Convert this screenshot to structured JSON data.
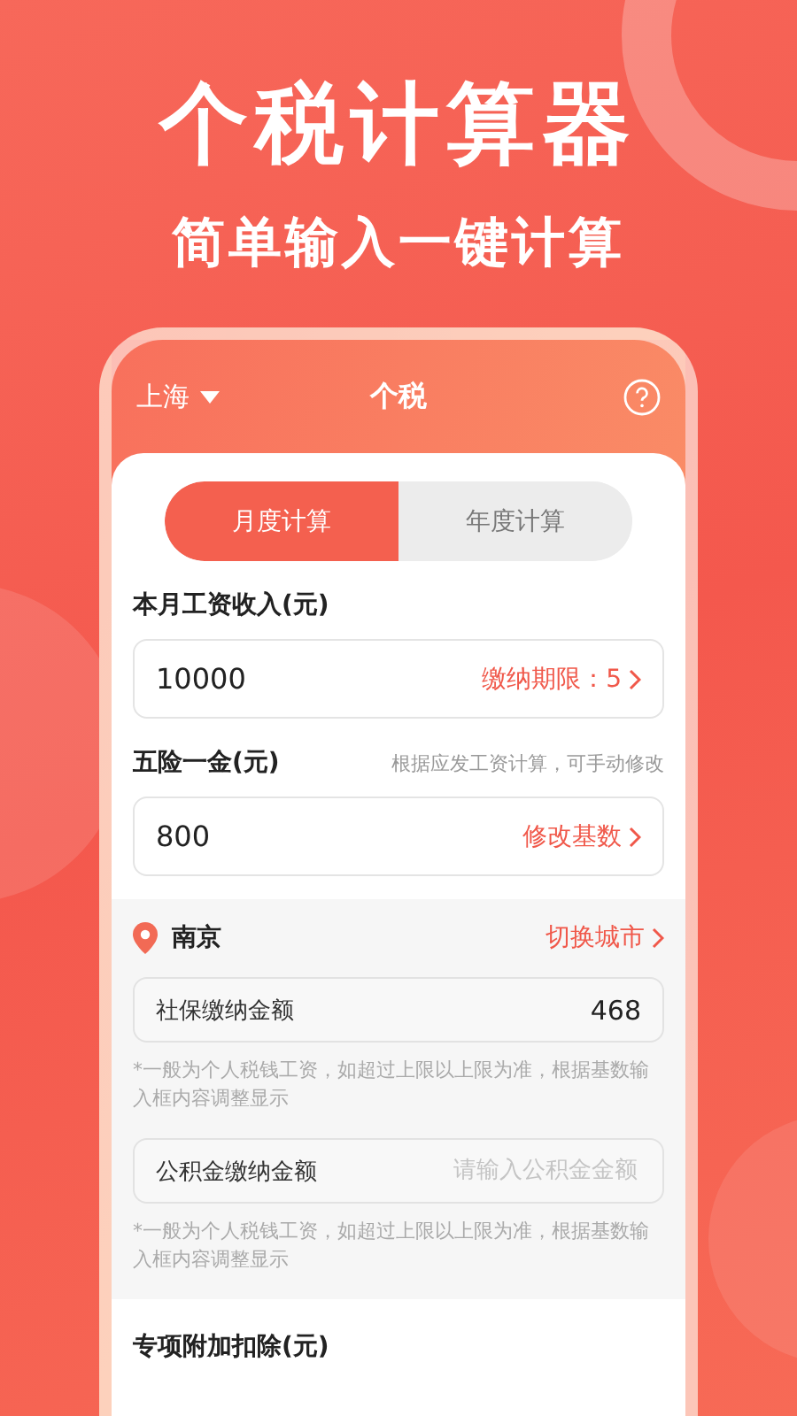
{
  "headline": "个税计算器",
  "subheadline": "简单输入一键计算",
  "app": {
    "city_selector": "上海",
    "title": "个税",
    "tabs": [
      {
        "label": "月度计算",
        "selected": true
      },
      {
        "label": "年度计算",
        "selected": false
      }
    ],
    "salary": {
      "label": "本月工资收入(元)",
      "value": "10000",
      "period_link": "缴纳期限：5"
    },
    "insurance": {
      "label": "五险一金(元)",
      "hint": "根据应发工资计算，可手动修改",
      "value": "800",
      "link": "修改基数"
    },
    "city_section": {
      "city": "南京",
      "switch_link": "切换城市",
      "social_security": {
        "label": "社保缴纳金额",
        "value": "468"
      },
      "social_note": "*一般为个人税钱工资，如超过上限以上限为准，根据基数输入框内容调整显示",
      "housing_fund": {
        "label": "公积金缴纳金额",
        "placeholder": "请输入公积金金额"
      },
      "housing_note": "*一般为个人税钱工资，如超过上限以上限为准，根据基数输入框内容调整显示"
    },
    "special_deduction": {
      "label": "专项附加扣除(元)"
    }
  }
}
